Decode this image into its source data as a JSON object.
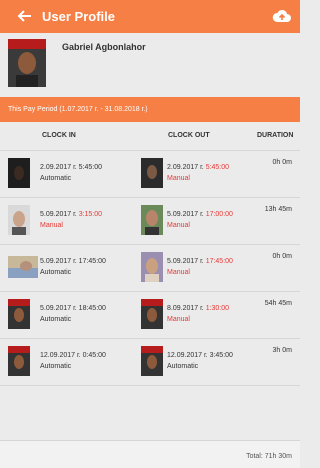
{
  "appbar": {
    "title": "User Profile",
    "back_icon": "arrow-left-icon",
    "action_icon": "cloud-icon"
  },
  "profile": {
    "name": "Gabriel Agbonlahor"
  },
  "period": {
    "label": "This Pay Period (1.07.2017 г. - 31.08.2018 г.)"
  },
  "columns": {
    "clock_in": "CLOCK IN",
    "clock_out": "CLOCK OUT",
    "duration": "DURATION"
  },
  "rows": [
    {
      "in_time": "2.09.2017 г. 5:45:00",
      "in_prefix": "",
      "in_mode": "Automatic",
      "in_manual": false,
      "out_prefix": "2.09.2017 г. ",
      "out_time": "5:45:00",
      "out_mode": "Manual",
      "out_manual": true,
      "duration": "0h  0m"
    },
    {
      "in_time": "3:15:00",
      "in_prefix": "5.09.2017 г. ",
      "in_mode": "Manual",
      "in_manual": true,
      "out_prefix": "5.09.2017 г. ",
      "out_time": "17:00:00",
      "out_mode": "Manual",
      "out_manual": true,
      "duration": "13h 45m"
    },
    {
      "in_time": "5.09.2017 г. 17:45:00",
      "in_prefix": "",
      "in_mode": "Automatic",
      "in_manual": false,
      "out_prefix": "5.09.2017 г. ",
      "out_time": "17:45:00",
      "out_mode": "Manual",
      "out_manual": true,
      "duration": "0h  0m"
    },
    {
      "in_time": "5.09.2017 г. 18:45:00",
      "in_prefix": "",
      "in_mode": "Automatic",
      "in_manual": false,
      "out_prefix": "8.09.2017 г. ",
      "out_time": "1:30:00",
      "out_mode": "Manual",
      "out_manual": true,
      "duration": "54h 45m"
    },
    {
      "in_time": "12.09.2017 г. 0:45:00",
      "in_prefix": "",
      "in_mode": "Automatic",
      "in_manual": false,
      "out_prefix": "",
      "out_time": "12.09.2017 г. 3:45:00",
      "out_mode": "Automatic",
      "out_manual": false,
      "duration": "3h  0m"
    }
  ],
  "footer": {
    "total": "Total: 71h 30m"
  },
  "colors": {
    "accent": "#f57f45",
    "manual": "#e53935"
  }
}
